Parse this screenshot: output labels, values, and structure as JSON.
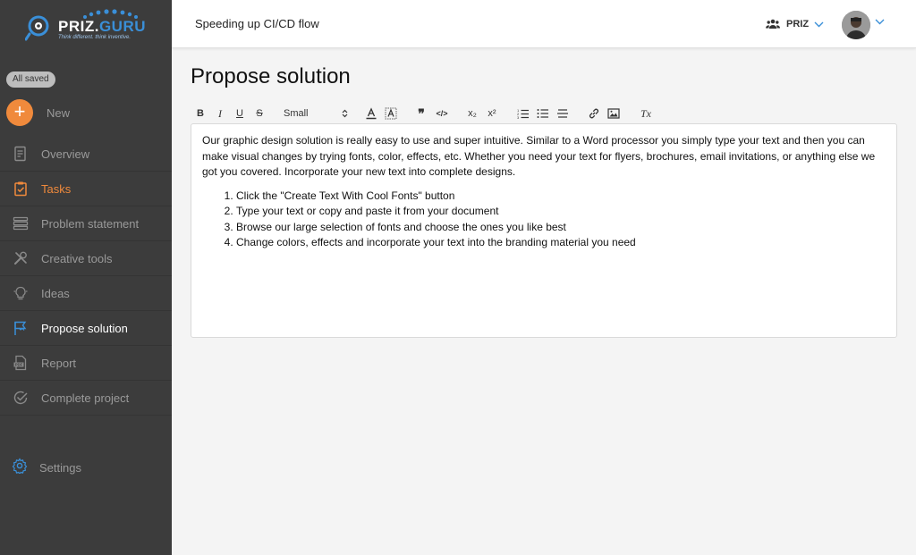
{
  "brand": {
    "name_main": "PRIZ.",
    "name_accent": "GURU",
    "tagline": "Think different. think inventive."
  },
  "sidebar": {
    "saved_status": "All saved",
    "new_label": "New",
    "items": [
      {
        "label": "Overview",
        "icon": "document-icon"
      },
      {
        "label": "Tasks",
        "icon": "clipboard-icon"
      },
      {
        "label": "Problem statement",
        "icon": "layers-icon"
      },
      {
        "label": "Creative tools",
        "icon": "tools-icon"
      },
      {
        "label": "Ideas",
        "icon": "lightbulb-icon"
      },
      {
        "label": "Propose solution",
        "icon": "flag-icon"
      },
      {
        "label": "Report",
        "icon": "pdf-icon"
      },
      {
        "label": "Complete project",
        "icon": "check-circle-icon"
      }
    ],
    "settings_label": "Settings"
  },
  "header": {
    "project_title": "Speeding up CI/CD flow",
    "org_name": "PRIZ"
  },
  "main": {
    "page_title": "Propose solution",
    "toolbar": {
      "bold": "B",
      "italic": "I",
      "underline": "U",
      "strike": "S",
      "size": "Small",
      "quote": "❞",
      "code": "</>",
      "subscript": "x₂",
      "superscript": "x²",
      "clear": "Tx"
    },
    "editor": {
      "paragraph": "Our graphic design solution is really easy to use and super intuitive. Similar to a Word processor you simply type your text and then you can make visual changes by trying fonts, color, effects, etc. Whether you need your text for flyers, brochures, email invitations, or anything else we got you covered. Incorporate your new text into complete designs.",
      "list": [
        "Click the \"Create Text With Cool Fonts\" button",
        "Type your text or copy and paste it from your document",
        "Browse our large selection of fonts and choose the ones you like best",
        "Change colors, effects and incorporate your text into the branding material you need"
      ]
    }
  },
  "colors": {
    "sidebar_bg": "#3c3c3c",
    "accent_orange": "#f08a3c",
    "accent_blue": "#3a8fd8"
  }
}
